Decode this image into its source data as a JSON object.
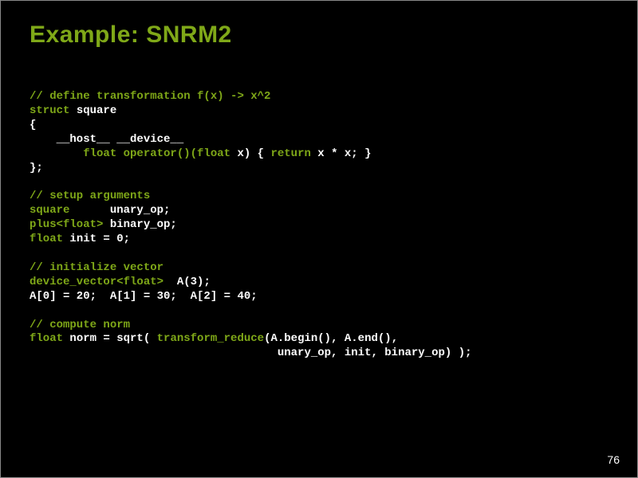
{
  "title": "Example: SNRM2",
  "page_number": "76",
  "c": {
    "c1": "// define transformation f(x) -> x^2",
    "c2": "struct",
    "c3": " square",
    "c4": "{",
    "c5": "    __host__ __device__",
    "c6": "        float operator()(float",
    "c7": " x) { ",
    "c8": "return",
    "c9": " x * x; }",
    "c10": "};",
    "c11": "// setup arguments",
    "c12": "square",
    "c13": "      unary_op;",
    "c14": "plus<float>",
    "c15": " binary_op;",
    "c16": "float",
    "c17": " init = 0;",
    "c18": "// initialize vector",
    "c19": "device_vector<float>",
    "c20": "  A(3);",
    "c21": "A[0] = 20;  A[1] = 30;  A[2] = 40;",
    "c22": "// compute norm",
    "c23": "float",
    "c24": " norm = sqrt( ",
    "c25": "transform_reduce",
    "c26": "(A.begin(), A.end(),",
    "c27": "                                     unary_op, init, binary_op) );"
  }
}
